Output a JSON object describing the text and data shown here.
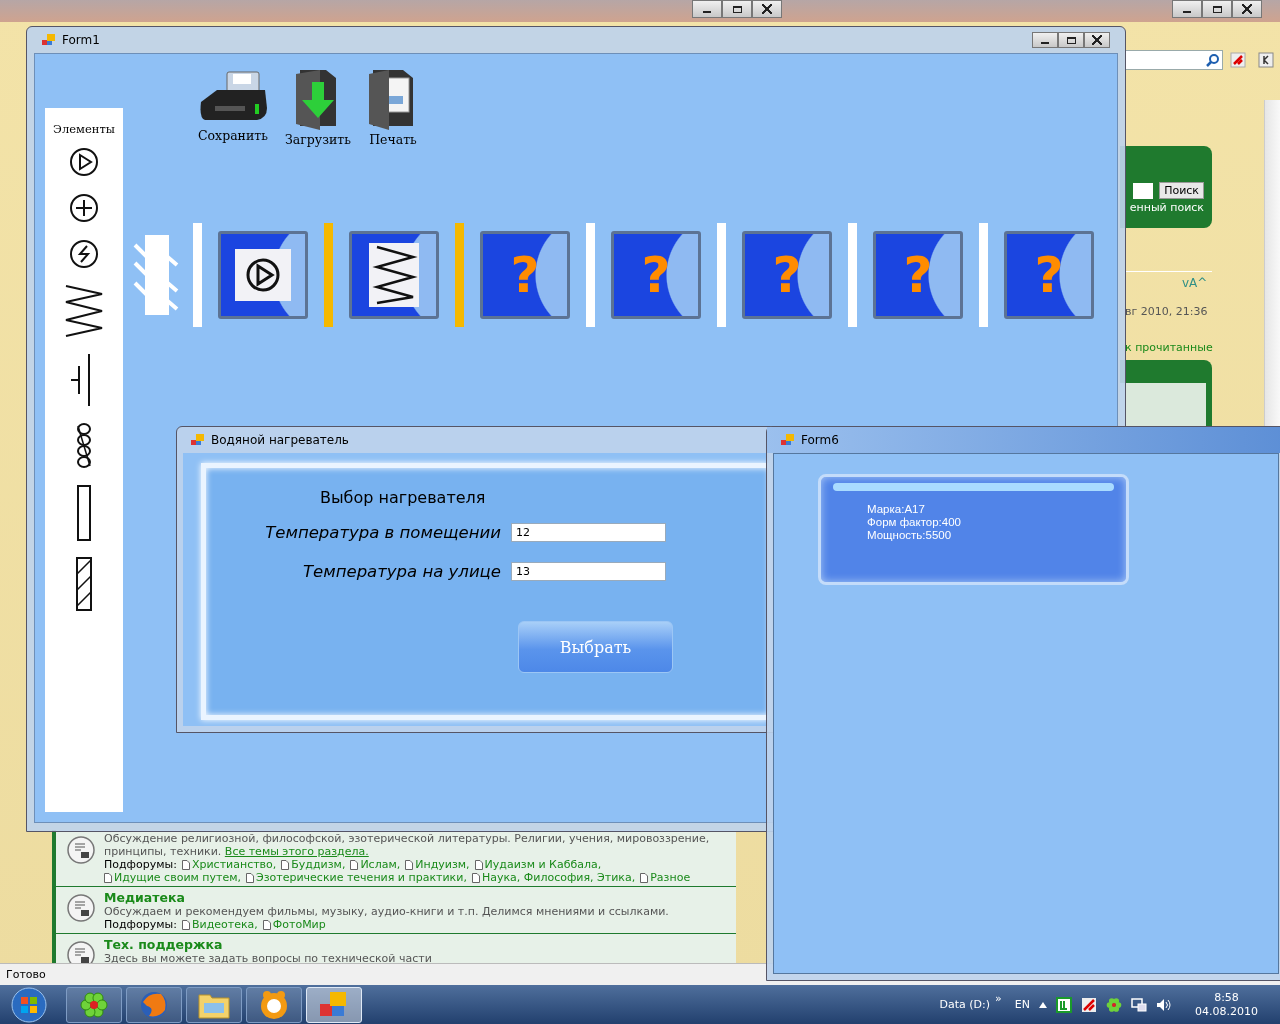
{
  "browser": {
    "search_button": "Поиск",
    "search_link": "енный поиск",
    "font_size_control": "vA^",
    "last_post_date": "вг 2010, 21:36",
    "mark_read_link": "к прочитанные",
    "forums": [
      {
        "description": "Обсуждение религиозной, философской, эзотерической литературы. Религии, учения, мировоззрение, принципы, техники.",
        "link": "Все темы этого раздела.",
        "subforums_label": "Подфорумы:",
        "subforums": [
          "Христианство,",
          "Буддизм,",
          "Ислам,",
          "Индуизм,",
          "Иудаизм и Каббала,",
          "Идущие своим путем,",
          "Эзотерические течения и практики,",
          "Наука, Философия, Этика,",
          "Разное"
        ]
      },
      {
        "title": "Медиатека",
        "description": "Обсуждаем и рекомендуем фильмы, музыку, аудио-книги и т.п. Делимся мнениями и ссылками.",
        "subforums_label": "Подфорумы:",
        "subforums": [
          "Видеотека,",
          "ФотоМир"
        ]
      },
      {
        "title": "Тех. поддержка",
        "description": "Здесь вы можете задать вопросы по технической части"
      }
    ],
    "status": "Готово"
  },
  "form1": {
    "title": "Form1",
    "toolbar": [
      {
        "kind": "save",
        "label": "Сохранить"
      },
      {
        "kind": "load",
        "label": "Загрузить"
      },
      {
        "kind": "print",
        "label": "Печать"
      }
    ],
    "palette": {
      "title": "Элементы",
      "items": [
        {
          "kind": "pump"
        },
        {
          "kind": "plus"
        },
        {
          "kind": "lightning"
        },
        {
          "kind": "spring"
        },
        {
          "kind": "capacitor"
        },
        {
          "kind": "coil"
        },
        {
          "kind": "resistor"
        },
        {
          "kind": "hatched"
        }
      ]
    },
    "circuit": [
      {
        "kind": "wall"
      },
      {
        "kind": "separator",
        "color": "#ffffff"
      },
      {
        "kind": "pump-tile"
      },
      {
        "kind": "separator",
        "color": "#f5b800"
      },
      {
        "kind": "spring-tile"
      },
      {
        "kind": "separator",
        "color": "#f5b800"
      },
      {
        "kind": "unknown-tile",
        "label": "?"
      },
      {
        "kind": "separator",
        "color": "#ffffff"
      },
      {
        "kind": "unknown-tile",
        "label": "?"
      },
      {
        "kind": "separator",
        "color": "#ffffff"
      },
      {
        "kind": "unknown-tile",
        "label": "?"
      },
      {
        "kind": "separator",
        "color": "#ffffff"
      },
      {
        "kind": "unknown-tile",
        "label": "?"
      },
      {
        "kind": "separator",
        "color": "#ffffff"
      },
      {
        "kind": "unknown-tile",
        "label": "?"
      }
    ]
  },
  "heater": {
    "title": "Водяной нагреватель",
    "heading": "Выбор нагревателя",
    "fields": [
      {
        "label": "Температура в помещении",
        "value": "12"
      },
      {
        "label": "Температура на улице",
        "value": "13"
      }
    ],
    "button": "Выбрать"
  },
  "form6": {
    "title": "Form6",
    "lines": [
      "Марка:A17",
      "Форм фактор:400",
      "Мощность:5500"
    ]
  },
  "taskbar": {
    "apps": [
      {
        "kind": "flower",
        "selected": false
      },
      {
        "kind": "globe",
        "selected": false
      },
      {
        "kind": "folder",
        "selected": false
      },
      {
        "kind": "player",
        "selected": false
      },
      {
        "kind": "form",
        "selected": true
      }
    ],
    "drive": "Data (D:)",
    "chevron": "»",
    "language": "EN",
    "time": "8:58",
    "date": "04.08.2010"
  }
}
